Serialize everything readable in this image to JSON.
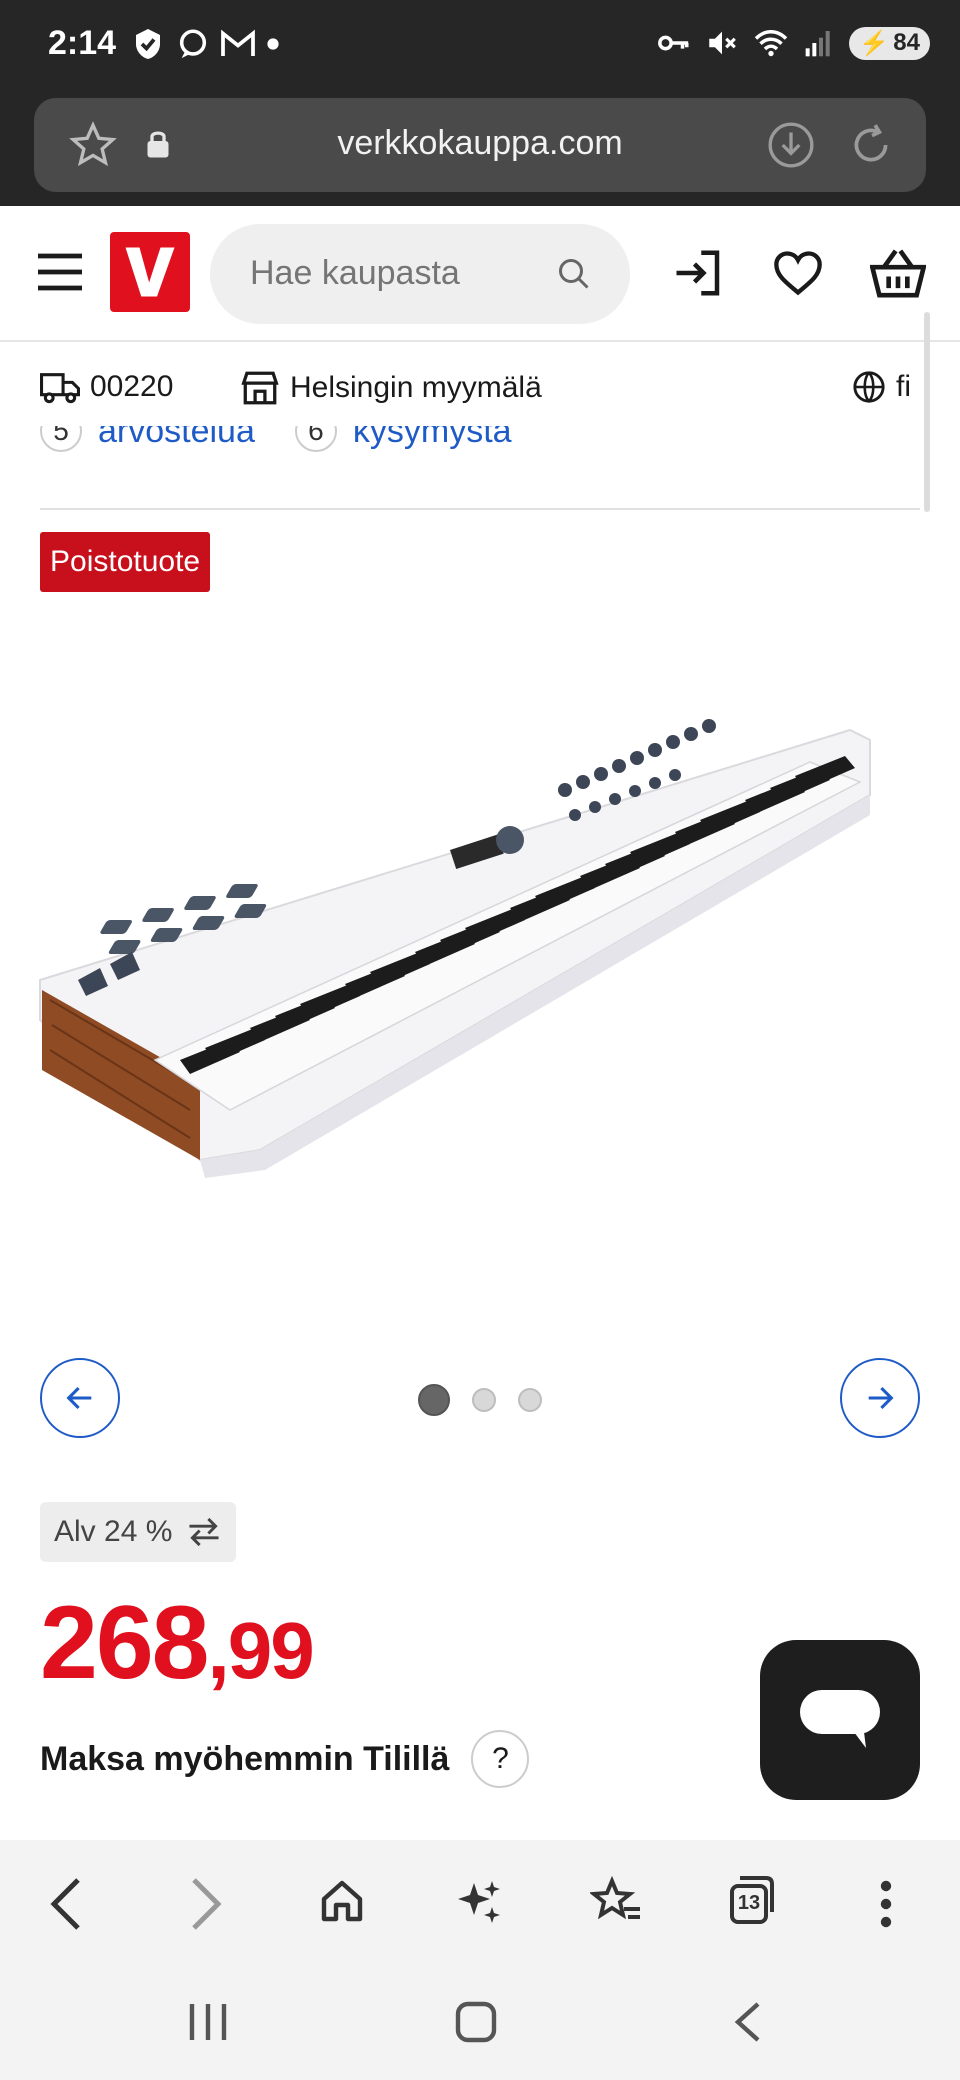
{
  "status_bar": {
    "time": "2:14",
    "battery": "84"
  },
  "browser": {
    "url": "verkkokauppa.com"
  },
  "header": {
    "logo_letter": "V",
    "search_placeholder": "Hae kaupasta"
  },
  "location": {
    "postal_code": "00220",
    "store": "Helsingin myymälä",
    "language": "fi"
  },
  "ratings": {
    "reviews_count": "5",
    "reviews_label": "arvostelua",
    "questions_count": "6",
    "questions_label": "kysymystä"
  },
  "product": {
    "badge": "Poistotuote",
    "image_slides": 3,
    "active_slide": 1,
    "vat_label": "Alv 24 %",
    "price_main": "268",
    "price_cents": ",99",
    "paylater_label": "Maksa myöhemmin Tilillä",
    "help_label": "?"
  },
  "browser_bottom": {
    "tabs_count": "13"
  },
  "colors": {
    "brand_red": "#e1101e",
    "link_blue": "#1e5bc6",
    "dark": "#262626"
  }
}
